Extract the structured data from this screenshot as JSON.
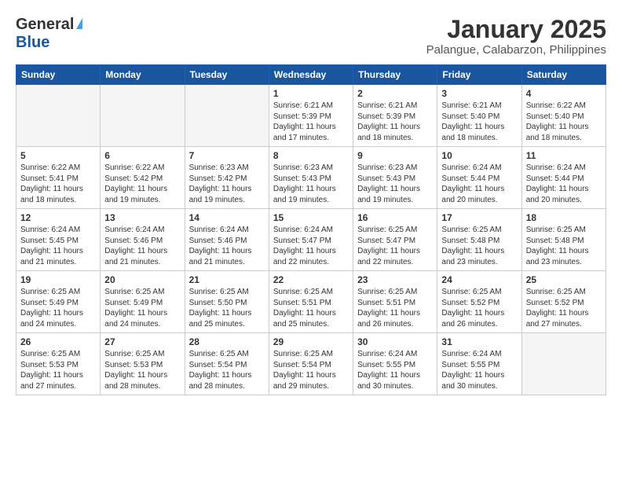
{
  "header": {
    "logo_general": "General",
    "logo_blue": "Blue",
    "title": "January 2025",
    "subtitle": "Palangue, Calabarzon, Philippines"
  },
  "days_of_week": [
    "Sunday",
    "Monday",
    "Tuesday",
    "Wednesday",
    "Thursday",
    "Friday",
    "Saturday"
  ],
  "weeks": [
    {
      "alt": false,
      "days": [
        {
          "num": "",
          "info": "",
          "empty": true
        },
        {
          "num": "",
          "info": "",
          "empty": true
        },
        {
          "num": "",
          "info": "",
          "empty": true
        },
        {
          "num": "1",
          "info": "Sunrise: 6:21 AM\nSunset: 5:39 PM\nDaylight: 11 hours\nand 17 minutes.",
          "empty": false
        },
        {
          "num": "2",
          "info": "Sunrise: 6:21 AM\nSunset: 5:39 PM\nDaylight: 11 hours\nand 18 minutes.",
          "empty": false
        },
        {
          "num": "3",
          "info": "Sunrise: 6:21 AM\nSunset: 5:40 PM\nDaylight: 11 hours\nand 18 minutes.",
          "empty": false
        },
        {
          "num": "4",
          "info": "Sunrise: 6:22 AM\nSunset: 5:40 PM\nDaylight: 11 hours\nand 18 minutes.",
          "empty": false
        }
      ]
    },
    {
      "alt": true,
      "days": [
        {
          "num": "5",
          "info": "Sunrise: 6:22 AM\nSunset: 5:41 PM\nDaylight: 11 hours\nand 18 minutes.",
          "empty": false
        },
        {
          "num": "6",
          "info": "Sunrise: 6:22 AM\nSunset: 5:42 PM\nDaylight: 11 hours\nand 19 minutes.",
          "empty": false
        },
        {
          "num": "7",
          "info": "Sunrise: 6:23 AM\nSunset: 5:42 PM\nDaylight: 11 hours\nand 19 minutes.",
          "empty": false
        },
        {
          "num": "8",
          "info": "Sunrise: 6:23 AM\nSunset: 5:43 PM\nDaylight: 11 hours\nand 19 minutes.",
          "empty": false
        },
        {
          "num": "9",
          "info": "Sunrise: 6:23 AM\nSunset: 5:43 PM\nDaylight: 11 hours\nand 19 minutes.",
          "empty": false
        },
        {
          "num": "10",
          "info": "Sunrise: 6:24 AM\nSunset: 5:44 PM\nDaylight: 11 hours\nand 20 minutes.",
          "empty": false
        },
        {
          "num": "11",
          "info": "Sunrise: 6:24 AM\nSunset: 5:44 PM\nDaylight: 11 hours\nand 20 minutes.",
          "empty": false
        }
      ]
    },
    {
      "alt": false,
      "days": [
        {
          "num": "12",
          "info": "Sunrise: 6:24 AM\nSunset: 5:45 PM\nDaylight: 11 hours\nand 21 minutes.",
          "empty": false
        },
        {
          "num": "13",
          "info": "Sunrise: 6:24 AM\nSunset: 5:46 PM\nDaylight: 11 hours\nand 21 minutes.",
          "empty": false
        },
        {
          "num": "14",
          "info": "Sunrise: 6:24 AM\nSunset: 5:46 PM\nDaylight: 11 hours\nand 21 minutes.",
          "empty": false
        },
        {
          "num": "15",
          "info": "Sunrise: 6:24 AM\nSunset: 5:47 PM\nDaylight: 11 hours\nand 22 minutes.",
          "empty": false
        },
        {
          "num": "16",
          "info": "Sunrise: 6:25 AM\nSunset: 5:47 PM\nDaylight: 11 hours\nand 22 minutes.",
          "empty": false
        },
        {
          "num": "17",
          "info": "Sunrise: 6:25 AM\nSunset: 5:48 PM\nDaylight: 11 hours\nand 23 minutes.",
          "empty": false
        },
        {
          "num": "18",
          "info": "Sunrise: 6:25 AM\nSunset: 5:48 PM\nDaylight: 11 hours\nand 23 minutes.",
          "empty": false
        }
      ]
    },
    {
      "alt": true,
      "days": [
        {
          "num": "19",
          "info": "Sunrise: 6:25 AM\nSunset: 5:49 PM\nDaylight: 11 hours\nand 24 minutes.",
          "empty": false
        },
        {
          "num": "20",
          "info": "Sunrise: 6:25 AM\nSunset: 5:49 PM\nDaylight: 11 hours\nand 24 minutes.",
          "empty": false
        },
        {
          "num": "21",
          "info": "Sunrise: 6:25 AM\nSunset: 5:50 PM\nDaylight: 11 hours\nand 25 minutes.",
          "empty": false
        },
        {
          "num": "22",
          "info": "Sunrise: 6:25 AM\nSunset: 5:51 PM\nDaylight: 11 hours\nand 25 minutes.",
          "empty": false
        },
        {
          "num": "23",
          "info": "Sunrise: 6:25 AM\nSunset: 5:51 PM\nDaylight: 11 hours\nand 26 minutes.",
          "empty": false
        },
        {
          "num": "24",
          "info": "Sunrise: 6:25 AM\nSunset: 5:52 PM\nDaylight: 11 hours\nand 26 minutes.",
          "empty": false
        },
        {
          "num": "25",
          "info": "Sunrise: 6:25 AM\nSunset: 5:52 PM\nDaylight: 11 hours\nand 27 minutes.",
          "empty": false
        }
      ]
    },
    {
      "alt": false,
      "days": [
        {
          "num": "26",
          "info": "Sunrise: 6:25 AM\nSunset: 5:53 PM\nDaylight: 11 hours\nand 27 minutes.",
          "empty": false
        },
        {
          "num": "27",
          "info": "Sunrise: 6:25 AM\nSunset: 5:53 PM\nDaylight: 11 hours\nand 28 minutes.",
          "empty": false
        },
        {
          "num": "28",
          "info": "Sunrise: 6:25 AM\nSunset: 5:54 PM\nDaylight: 11 hours\nand 28 minutes.",
          "empty": false
        },
        {
          "num": "29",
          "info": "Sunrise: 6:25 AM\nSunset: 5:54 PM\nDaylight: 11 hours\nand 29 minutes.",
          "empty": false
        },
        {
          "num": "30",
          "info": "Sunrise: 6:24 AM\nSunset: 5:55 PM\nDaylight: 11 hours\nand 30 minutes.",
          "empty": false
        },
        {
          "num": "31",
          "info": "Sunrise: 6:24 AM\nSunset: 5:55 PM\nDaylight: 11 hours\nand 30 minutes.",
          "empty": false
        },
        {
          "num": "",
          "info": "",
          "empty": true
        }
      ]
    }
  ]
}
